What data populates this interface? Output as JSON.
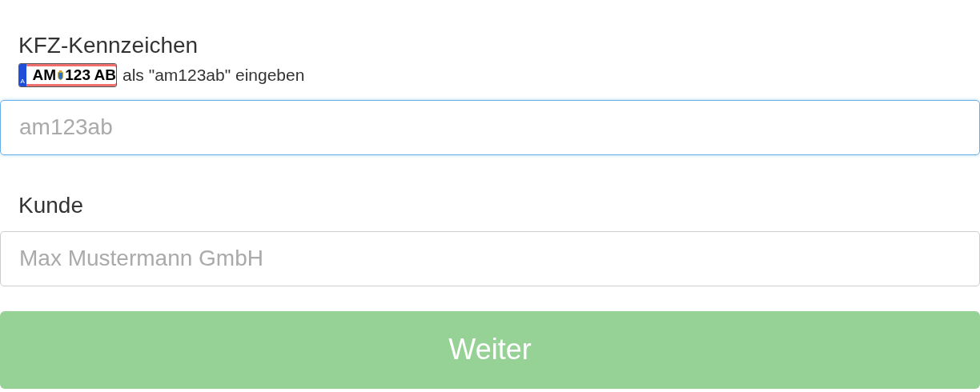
{
  "plate_field": {
    "label": "KFZ-Kennzeichen",
    "hint": {
      "plate": {
        "country": "A",
        "district": "AM",
        "number": "123 AB"
      },
      "text": "als \"am123ab\" eingeben"
    },
    "placeholder": "am123ab",
    "focused": true
  },
  "customer_field": {
    "label": "Kunde",
    "placeholder": "Max Mustermann GmbH",
    "focused": false
  },
  "submit_button": {
    "label": "Weiter"
  }
}
